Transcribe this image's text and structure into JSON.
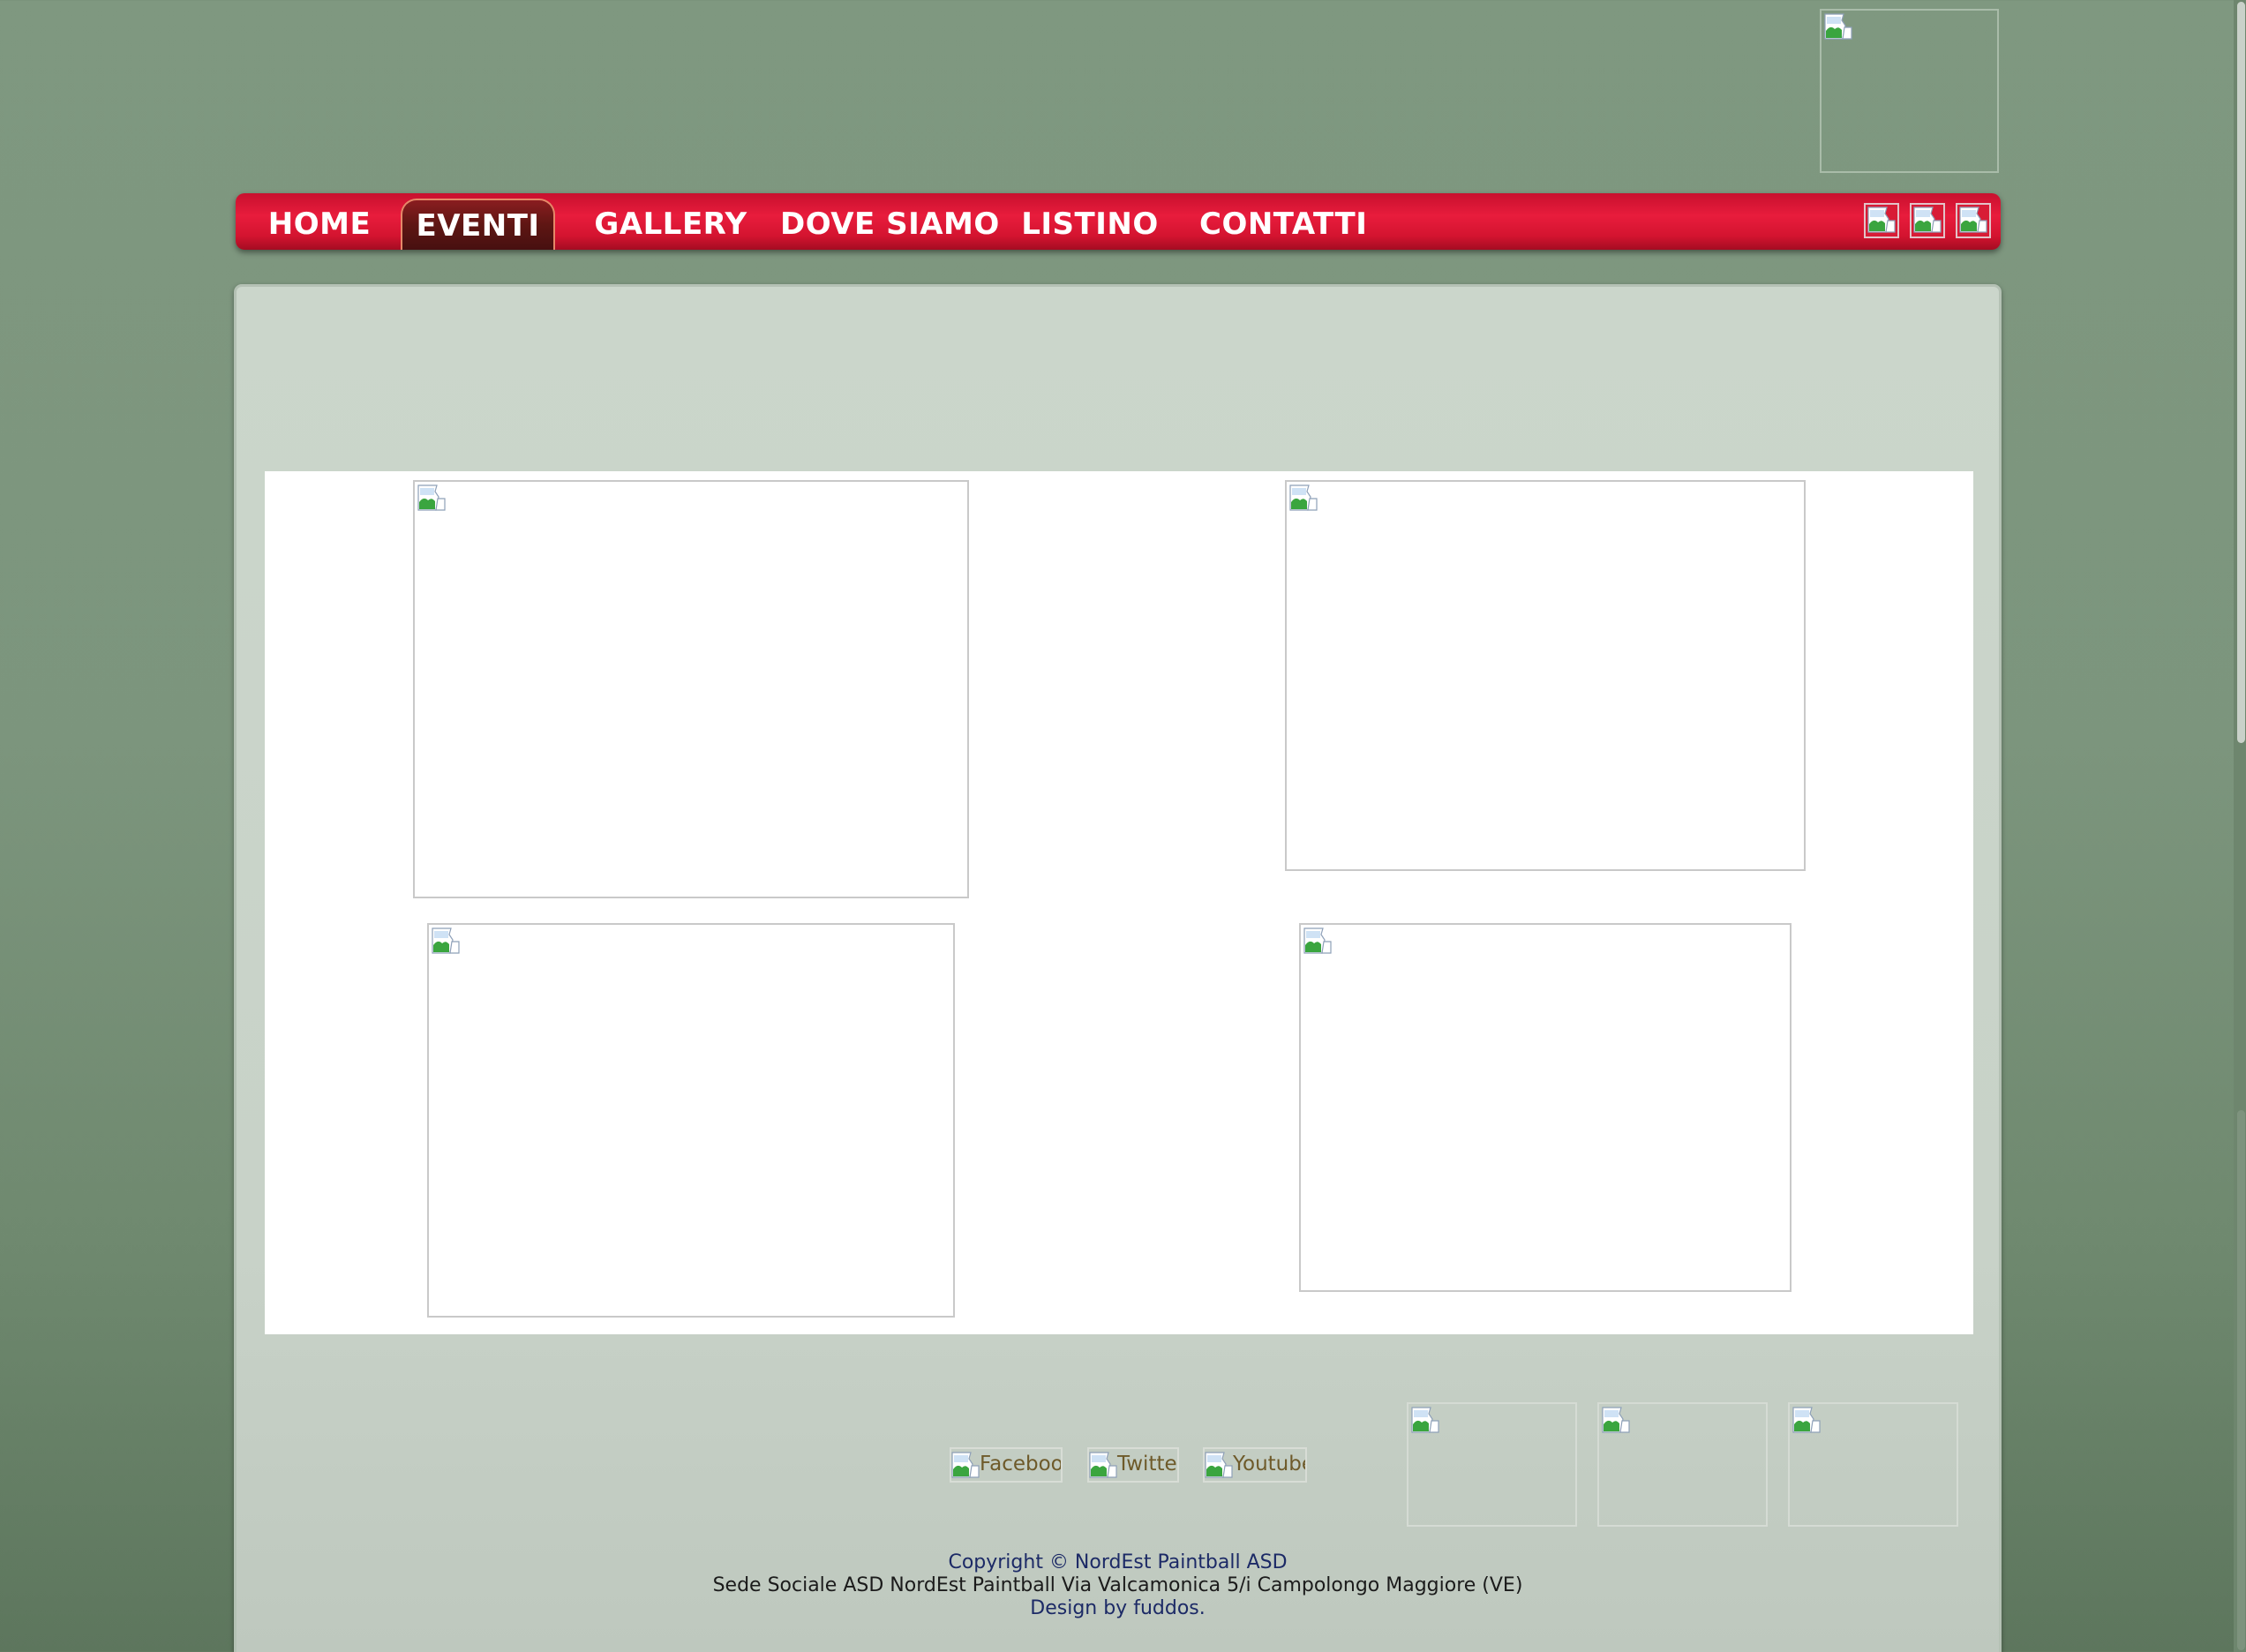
{
  "header": {
    "logo_icon": "broken-image-icon"
  },
  "nav": {
    "items": [
      {
        "label": "HOME",
        "active": false
      },
      {
        "label": "EVENTI",
        "active": true
      },
      {
        "label": "GALLERY",
        "active": false
      },
      {
        "label": "DOVE SIAMO",
        "active": false
      },
      {
        "label": "LISTINO",
        "active": false
      },
      {
        "label": "CONTATTI",
        "active": false
      }
    ],
    "icons": [
      "broken-image-icon",
      "broken-image-icon",
      "broken-image-icon"
    ]
  },
  "content": {
    "images": [
      "broken-image-icon",
      "broken-image-icon",
      "broken-image-icon",
      "broken-image-icon"
    ]
  },
  "footer": {
    "social": {
      "facebook": "Facebook",
      "twitter": "Twitter",
      "youtube": "Youtube"
    },
    "sponsors": [
      "broken-image-icon",
      "broken-image-icon",
      "broken-image-icon"
    ],
    "copyright": "Copyright © NordEst Paintball ASD",
    "address": "Sede Sociale ASD NordEst Paintball Via Valcamonica 5/i Campolongo Maggiore (VE)",
    "design": "Design by fuddos."
  },
  "colors": {
    "background": "#7f9880",
    "nav_red": "#e81c3c",
    "nav_active": "#5e1613",
    "panel": "#cbd6cb",
    "social_text": "#6e5a2a",
    "footer_link": "#1c2a66"
  }
}
